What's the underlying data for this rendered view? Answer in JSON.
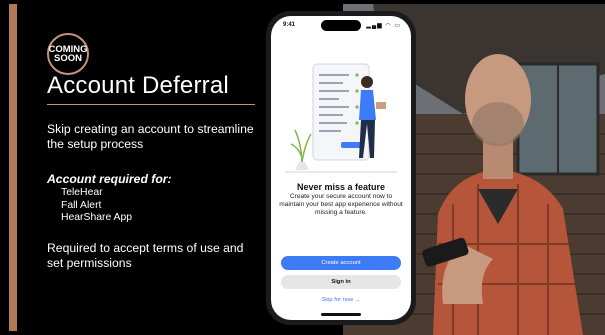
{
  "slide": {
    "badge_line1": "COMING",
    "badge_line2": "SOON",
    "title": "Account Deferral",
    "lead": "Skip creating an account to streamline the setup process",
    "required_heading": "Account required for:",
    "required_items": [
      "TeleHear",
      "Fall Alert",
      "HearShare App"
    ],
    "terms": "Required to accept terms of use and set permissions"
  },
  "phone": {
    "time": "9:41",
    "heading": "Never miss a feature",
    "body": "Create your secure account now to maintain your best app experience without missing a feature.",
    "create_label": "Create account",
    "signin_label": "Sign in",
    "skip_label": "Skip for now →"
  },
  "colors": {
    "accent": "#c69378",
    "primary_button": "#3d7bf7"
  }
}
